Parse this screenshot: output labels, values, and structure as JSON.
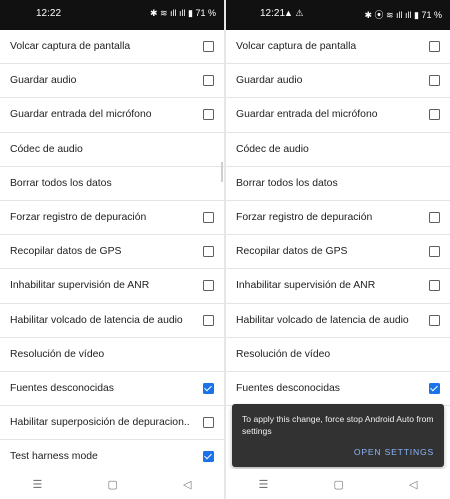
{
  "left": {
    "status": {
      "time": "12:22",
      "right": "✱ ≋ ıll ıll ▮ 71 %"
    },
    "items": [
      {
        "label": "Volcar captura de pantalla",
        "checkbox": "unchecked"
      },
      {
        "label": "Guardar audio",
        "checkbox": "unchecked"
      },
      {
        "label": "Guardar entrada del micrófono",
        "checkbox": "unchecked"
      },
      {
        "label": "Códec de audio",
        "checkbox": "none"
      },
      {
        "label": "Borrar todos los datos",
        "checkbox": "none"
      },
      {
        "label": "Forzar registro de depuración",
        "checkbox": "unchecked"
      },
      {
        "label": "Recopilar datos de GPS",
        "checkbox": "unchecked"
      },
      {
        "label": "Inhabilitar supervisión de ANR",
        "checkbox": "unchecked"
      },
      {
        "label": "Habilitar volcado de latencia de audio",
        "checkbox": "unchecked"
      },
      {
        "label": "Resolución de vídeo",
        "checkbox": "none"
      },
      {
        "label": "Fuentes desconocidas",
        "checkbox": "checked"
      },
      {
        "label": "Habilitar superposición de depuracion..",
        "checkbox": "unchecked"
      },
      {
        "label": "Test harness mode",
        "checkbox": "checked"
      }
    ],
    "nav": {
      "recents": "☰",
      "home": "▢",
      "back": "◁"
    }
  },
  "right": {
    "status": {
      "time": "12:21",
      "left_icons": "▲ ⚠",
      "right": "✱ ⦿ ≋ ıll ıll ▮ 71 %"
    },
    "items": [
      {
        "label": "Volcar captura de pantalla",
        "checkbox": "unchecked"
      },
      {
        "label": "Guardar audio",
        "checkbox": "unchecked"
      },
      {
        "label": "Guardar entrada del micrófono",
        "checkbox": "unchecked"
      },
      {
        "label": "Códec de audio",
        "checkbox": "none"
      },
      {
        "label": "Borrar todos los datos",
        "checkbox": "none"
      },
      {
        "label": "Forzar registro de depuración",
        "checkbox": "unchecked"
      },
      {
        "label": "Recopilar datos de GPS",
        "checkbox": "unchecked"
      },
      {
        "label": "Inhabilitar supervisión de ANR",
        "checkbox": "unchecked"
      },
      {
        "label": "Habilitar volcado de latencia de audio",
        "checkbox": "unchecked"
      },
      {
        "label": "Resolución de vídeo",
        "checkbox": "none"
      },
      {
        "label": "Fuentes desconocidas",
        "checkbox": "checked"
      }
    ],
    "snackbar": {
      "message": "To apply this change, force stop Android Auto from settings",
      "action": "OPEN SETTINGS"
    },
    "nav": {
      "recents": "☰",
      "home": "▢",
      "back": "◁"
    }
  },
  "colors": {
    "accent": "#1a73e8",
    "snackbar_bg": "#323232",
    "snackbar_action": "#8ab4f8"
  }
}
